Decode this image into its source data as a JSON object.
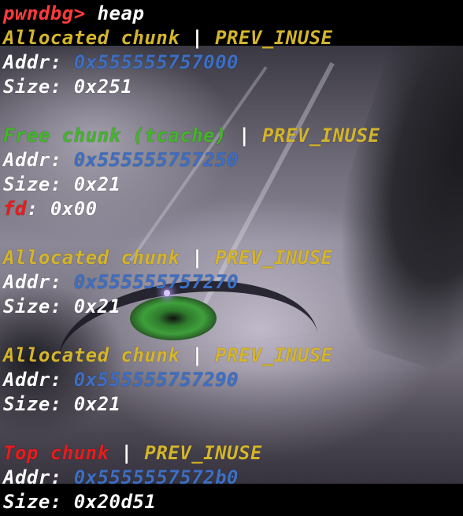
{
  "terminal": {
    "prompt": "pwndbg>",
    "command": "heap"
  },
  "separator": "|",
  "chunks": [
    {
      "type_label": "Allocated chunk",
      "flag": "PREV_INUSE",
      "addr_label": "Addr:",
      "addr": "0x555555757000",
      "size_label": "Size:",
      "size": "0x251"
    },
    {
      "type_label": "Free chunk (tcache)",
      "flag": "PREV_INUSE",
      "addr_label": "Addr:",
      "addr": "0x555555757250",
      "size_label": "Size:",
      "size": "0x21",
      "fd_label": "fd",
      "fd_sep": ":",
      "fd": "0x00"
    },
    {
      "type_label": "Allocated chunk",
      "flag": "PREV_INUSE",
      "addr_label": "Addr:",
      "addr": "0x555555757270",
      "size_label": "Size:",
      "size": "0x21"
    },
    {
      "type_label": "Allocated chunk",
      "flag": "PREV_INUSE",
      "addr_label": "Addr:",
      "addr": "0x555555757290",
      "size_label": "Size:",
      "size": "0x21"
    },
    {
      "type_label": "Top chunk",
      "flag": "PREV_INUSE",
      "addr_label": "Addr:",
      "addr": "0x5555557572b0",
      "size_label": "Size:",
      "size": "0x20d51"
    }
  ],
  "colors": {
    "prompt": "#ff3b3b",
    "allocated": "#d4b52c",
    "free": "#43b62a",
    "top": "#e81c1c",
    "flag": "#d4b52c",
    "address": "#3d6fc4",
    "text": "#ffffff",
    "background": "#000000"
  },
  "wallpaper": "anime-eye-wallpaper"
}
